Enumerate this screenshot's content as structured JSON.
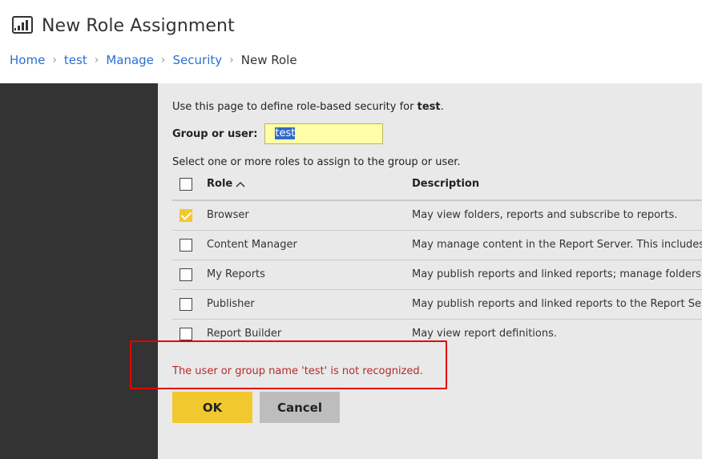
{
  "page": {
    "title": "New Role Assignment",
    "title_icon": "powerbi-report-icon"
  },
  "breadcrumb": {
    "items": [
      "Home",
      "test",
      "Manage",
      "Security"
    ],
    "current": "New Role"
  },
  "form": {
    "intro_prefix": "Use this page to define role-based security for ",
    "intro_item": "test",
    "intro_suffix": ".",
    "group_label": "Group or user:",
    "group_value": "test",
    "select_instruction": "Select one or more roles to assign to the group or user."
  },
  "table": {
    "headers": {
      "role": "Role",
      "description": "Description"
    },
    "sort_icon": "chevron-up-icon",
    "rows": [
      {
        "role": "Browser",
        "description": "May view folders, reports and subscribe to reports.",
        "checked": true
      },
      {
        "role": "Content Manager",
        "description": "May manage content in the Report Server. This includes folders, reports and resources.",
        "checked": false
      },
      {
        "role": "My Reports",
        "description": "May publish reports and linked reports; manage folders, reports and resources in a users My Reports folder.",
        "checked": false
      },
      {
        "role": "Publisher",
        "description": "May publish reports and linked reports to the Report Server.",
        "checked": false
      },
      {
        "role": "Report Builder",
        "description": "May view report definitions.",
        "checked": false
      }
    ]
  },
  "error": {
    "message": "The user or group name 'test' is not recognized."
  },
  "buttons": {
    "ok": "OK",
    "cancel": "Cancel"
  },
  "colors": {
    "accent_yellow": "#f2c82f",
    "link_blue": "#2b6fd0",
    "error_red": "#b52a2a",
    "highlight_box": "#e60000",
    "nav_dark": "#333333"
  }
}
